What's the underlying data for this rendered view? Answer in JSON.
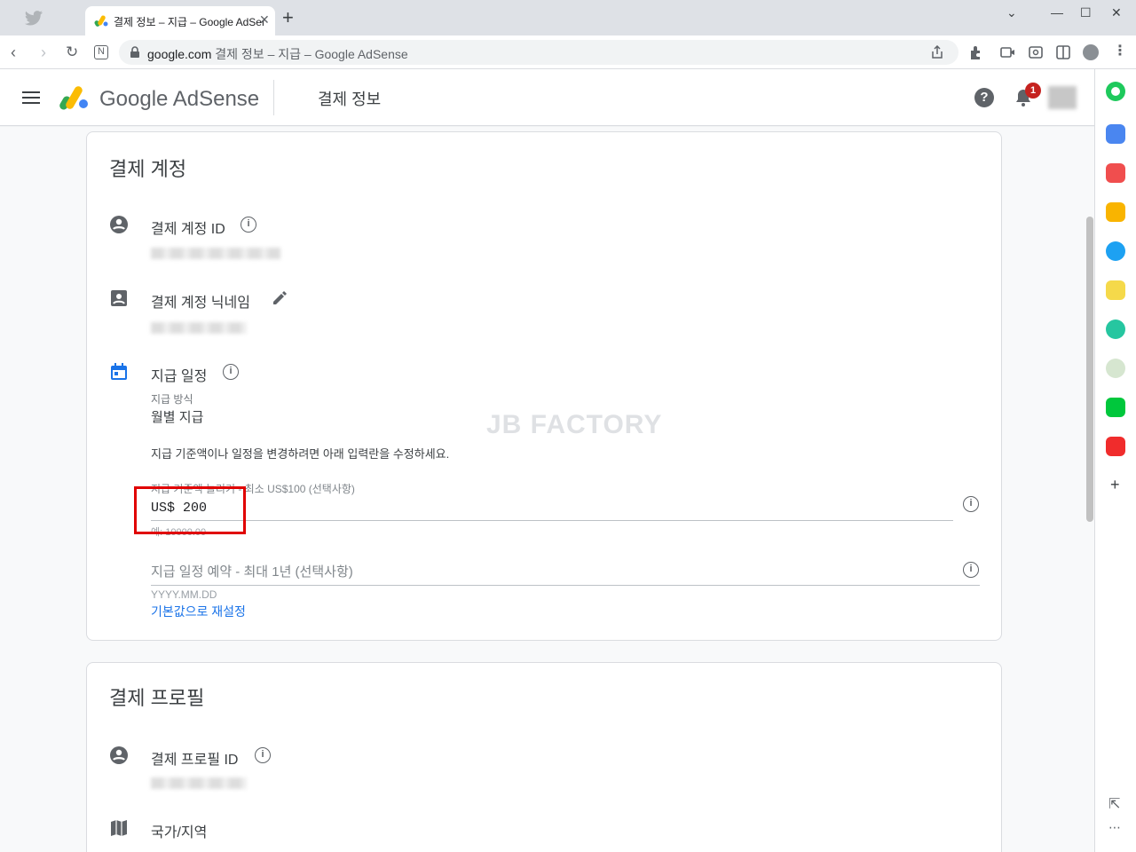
{
  "browser": {
    "tab_title": "결제 정보 – 지급 – Google AdSense",
    "url_domain": "google.com",
    "url_rest": "결제 정보 – 지급 – Google AdSense",
    "new_tab": "+"
  },
  "header": {
    "brand": "Google AdSense",
    "page_title": "결제 정보",
    "notification_count": "1"
  },
  "payment_account": {
    "title": "결제 계정",
    "id_label": "결제 계정 ID",
    "nickname_label": "결제 계정 닉네임",
    "schedule_label": "지급 일정",
    "method_label": "지급 방식",
    "method_value": "월별 지급",
    "note": "지급 기준액이나 일정을 변경하려면 아래 입력란을 수정하세요.",
    "threshold_label": "지급 기준액 늘리기 - 최소 US$100 (선택사항)",
    "threshold_value": "US$ 200",
    "threshold_hint": "예: 10000.00",
    "schedule_placeholder": "지급 일정 예약 - 최대 1년 (선택사항)",
    "schedule_hint": "YYYY.MM.DD",
    "reset_link": "기본값으로 재설정"
  },
  "payment_profile": {
    "title": "결제 프로필",
    "id_label": "결제 프로필 ID",
    "country_label": "국가/지역"
  },
  "watermark": "JB FACTORY",
  "colors": {
    "accent": "#1a73e8",
    "highlight": "#e00000",
    "badge": "#c5221f"
  }
}
